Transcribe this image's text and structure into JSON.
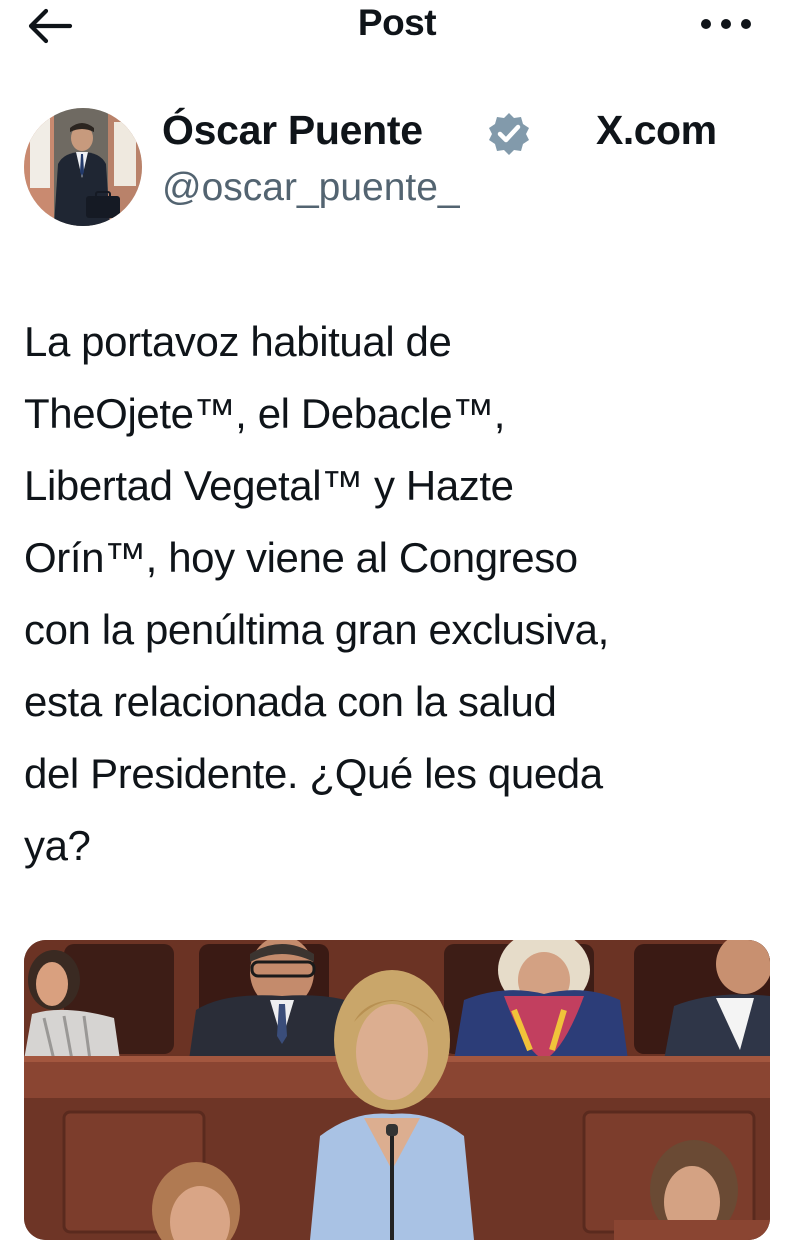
{
  "header": {
    "title": "Post",
    "back_icon": "arrow-left-icon",
    "more_icon": "more-horizontal-icon"
  },
  "author": {
    "name": "Óscar Puente",
    "handle": "@oscar_puente_",
    "verified_icon": "verified-badge-icon",
    "verified_color": "#829aab"
  },
  "watermark": {
    "text": "X.com"
  },
  "post": {
    "lines": [
      "La portavoz habitual de",
      "TheOjete™, el Debacle™,",
      "Libertad Vegetal™ y Hazte",
      "Orín™, hoy viene al Congreso",
      "con la penúltima gran exclusiva,",
      "esta relacionada con la salud",
      "del Presidente. ¿Qué les queda",
      "ya?"
    ]
  },
  "colors": {
    "text": "#0f1419",
    "secondary_text": "#536471",
    "background": "#ffffff"
  }
}
